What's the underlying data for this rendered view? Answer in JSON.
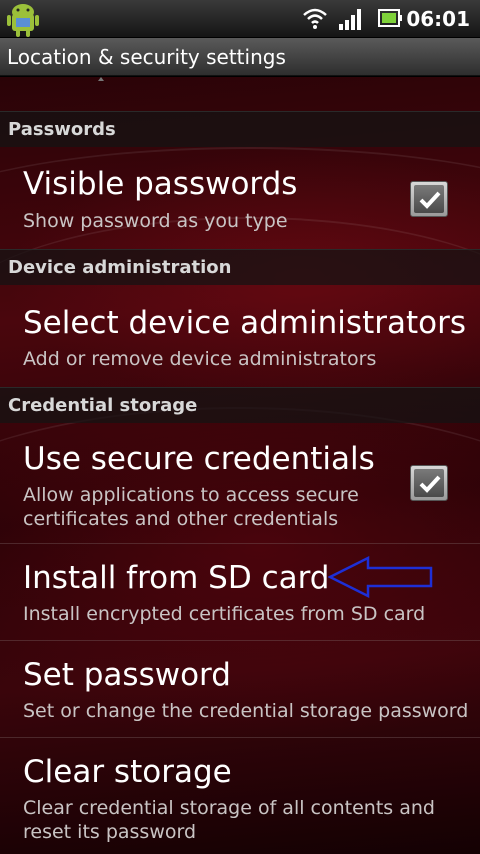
{
  "status_bar": {
    "time": "06:01",
    "icons": [
      "android-notification-icon",
      "wifi-icon",
      "signal-icon",
      "battery-icon"
    ]
  },
  "title_bar": {
    "title": "Location & security settings"
  },
  "sections": [
    {
      "header": "Passwords"
    },
    {
      "header": "Device administration"
    },
    {
      "header": "Credential storage"
    }
  ],
  "items": {
    "visible_passwords": {
      "title": "Visible passwords",
      "summary": "Show password as you type",
      "checked": true
    },
    "device_admins": {
      "title": "Select device administrators",
      "summary": "Add or remove device administrators"
    },
    "secure_credentials": {
      "title": "Use secure credentials",
      "summary_line1": "Allow applications to access secure",
      "summary_line2": "certificates and other credentials",
      "checked": true
    },
    "install_sd": {
      "title": "Install from SD card",
      "summary": "Install encrypted certificates from SD card"
    },
    "set_password": {
      "title": "Set password",
      "summary": "Set or change the credential storage password"
    },
    "clear_storage": {
      "title": "Clear storage",
      "summary_line1": "Clear credential storage of all contents and",
      "summary_line2": "reset its password"
    }
  },
  "colors": {
    "annotation_arrow": "#1e2fd6",
    "background": "#3a050b",
    "header": "#d8d8d8"
  }
}
